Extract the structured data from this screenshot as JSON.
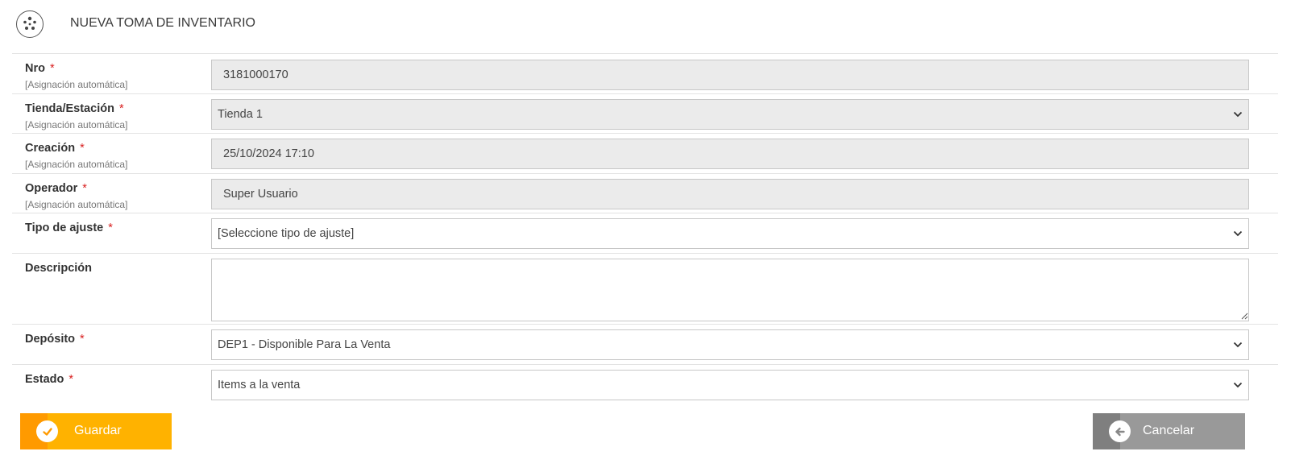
{
  "header": {
    "title": "NUEVA TOMA DE INVENTARIO",
    "icon": "dotted-circle-icon"
  },
  "form": {
    "nro": {
      "label": "Nro",
      "required": "*",
      "hint": "[Asignación automática]",
      "value": "3181000170"
    },
    "tienda": {
      "label": "Tienda/Estación",
      "required": "*",
      "hint": "[Asignación automática]",
      "value": "Tienda 1"
    },
    "creacion": {
      "label": "Creación",
      "required": "*",
      "hint": "[Asignación automática]",
      "value": "25/10/2024 17:10"
    },
    "operador": {
      "label": "Operador",
      "required": "*",
      "hint": "[Asignación automática]",
      "value": "Super Usuario"
    },
    "tipo_ajuste": {
      "label": "Tipo de ajuste",
      "required": "*",
      "value": "[Seleccione tipo de ajuste]"
    },
    "descripcion": {
      "label": "Descripción",
      "value": ""
    },
    "deposito": {
      "label": "Depósito",
      "required": "*",
      "value": "DEP1 - Disponible Para La Venta"
    },
    "estado": {
      "label": "Estado",
      "required": "*",
      "value": "Items a la venta"
    }
  },
  "actions": {
    "save_label": "Guardar",
    "cancel_label": "Cancelar"
  },
  "colors": {
    "save": "#ffb200",
    "save_accent": "#ff9a00",
    "cancel": "#999999",
    "cancel_accent": "#7f7f7f",
    "required": "#d81e1e"
  }
}
